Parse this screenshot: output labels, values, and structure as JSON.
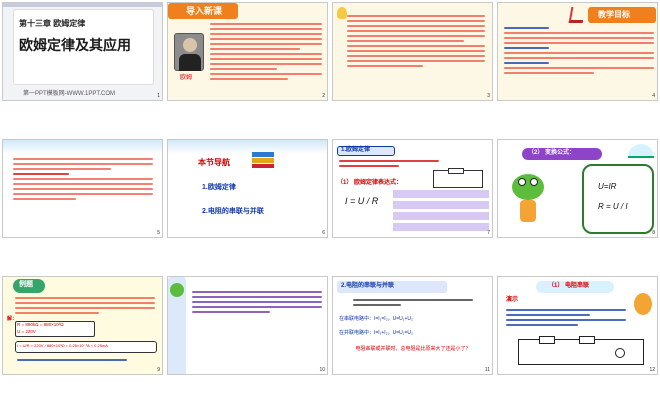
{
  "slides": [
    {
      "n": "1",
      "chapter": "第十三章 欧姆定律",
      "title": "欧姆定律及其应用",
      "footer": "第一PPT模板网-WWW.1PPT.COM"
    },
    {
      "n": "2",
      "heading": "导入新课",
      "person": "欧姆"
    },
    {
      "n": "3"
    },
    {
      "n": "4",
      "heading": "教学目标"
    },
    {
      "n": "5"
    },
    {
      "n": "6",
      "heading": "本节导航",
      "item1": "1.欧姆定律",
      "item2": "2.电阻的串联与并联"
    },
    {
      "n": "7",
      "head": "1.欧姆定律",
      "formula": "I = U / R",
      "formula_head": "（1） 欧姆定律表达式："
    },
    {
      "n": "8",
      "head": "（2） 变换公式：",
      "f1": "U=IR",
      "f2": "R = U / I"
    },
    {
      "n": "9",
      "badge": "例题",
      "l1": "R = 880kΩ = 880×10³Ω",
      "l2": "U = 220V",
      "l3": "I = U/R = 220V / 880×10³Ω = 0.25×10⁻³A = 0.25mA",
      "answer_tag": "解："
    },
    {
      "n": "10"
    },
    {
      "n": "11",
      "head": "2.电阻的串联与并联",
      "s1": "在串联电路中：I=I₁=I₂，U=U₁+U₂",
      "s2": "在并联电路中：I=I₁+I₂，U=U₁=U₂",
      "q": "电阻串联或并联时，总电阻是比原来大了还是小了？"
    },
    {
      "n": "12",
      "head": "（1） 电阻串联",
      "demo": "演示"
    }
  ],
  "colors": {
    "red": "#d60000",
    "blue": "#1038a8",
    "orange": "#f39b1b",
    "purple": "#6a2fa4",
    "green": "#3a9d3a"
  }
}
